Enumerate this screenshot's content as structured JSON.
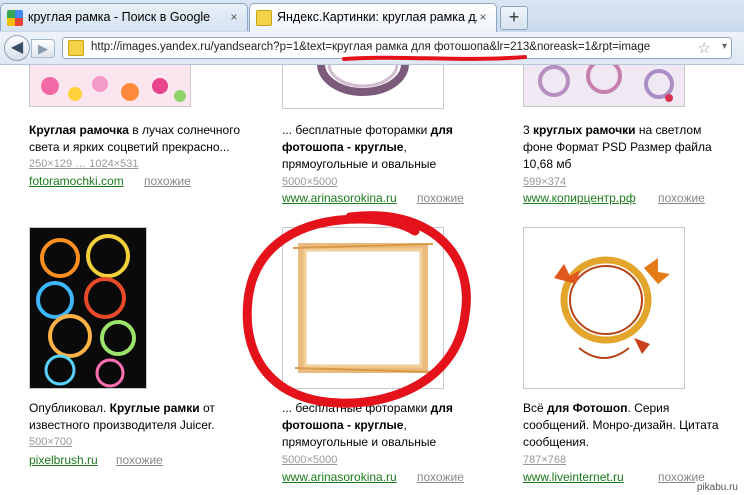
{
  "browser": {
    "tabs": [
      {
        "title": "круглая рамка - Поиск в Google",
        "icon": "google-icon",
        "active": false
      },
      {
        "title": "Яндекс.Картинки: круглая рамка дл...",
        "icon": "yandex-icon",
        "active": true
      }
    ],
    "new_tab_label": "+",
    "close_label": "×",
    "url": "http://images.yandex.ru/yandsearch?p=1&text=круглая рамка для фотошопа&lr=213&noreask=1&rpt=image",
    "back_glyph": "◀",
    "forward_glyph": "▶",
    "star_glyph": "☆",
    "drop_glyph": "▾"
  },
  "results": {
    "row1": [
      {
        "snippet_pre": "",
        "snippet_bold": "Круглая рамочка",
        "snippet_post": " в лучах солнечного света и ярких соцветий прекрасно...",
        "size": "250×129 … 1024×531",
        "source": "fotoramochki.com",
        "similar": "похожие"
      },
      {
        "snippet_pre": "... бесплатные фоторамки ",
        "snippet_bold": "для фотошопа - круглые",
        "snippet_post": ", прямоугольные и овальные",
        "size": "5000×5000",
        "source": "www.arinasorokina.ru",
        "similar": "похожие"
      },
      {
        "snippet_pre": "3 ",
        "snippet_bold": "круглых рамочки",
        "snippet_post": " на светлом фоне Формат PSD Размер файла 10,68 мб",
        "size": "599×374",
        "source": "www.копирцентр.рф",
        "similar": "похожие"
      }
    ],
    "row2": [
      {
        "snippet_pre": "Опубликовал. ",
        "snippet_bold": "Круглые рамки",
        "snippet_post": " от известного производителя Juicer.",
        "size": "500×700",
        "source": "pixelbrush.ru",
        "similar": "похожие"
      },
      {
        "snippet_pre": "... бесплатные фоторамки ",
        "snippet_bold": "для фотошопа - круглые",
        "snippet_post": ", прямоугольные и овальные",
        "size": "5000×5000",
        "source": "www.arinasorokina.ru",
        "similar": "похожие"
      },
      {
        "snippet_pre": "Всё ",
        "snippet_bold": "для Фотошоп",
        "snippet_post": ". Серия сообщений. Монро-дизайн. Цитата сообщения.",
        "size": "787×768",
        "source": "www.liveinternet.ru",
        "similar": "похожие"
      }
    ]
  },
  "watermark": "pikabu.ru",
  "colors": {
    "annotation_red": "#e4121b",
    "source_green": "#1b7a1b",
    "link_gray": "#888888"
  }
}
